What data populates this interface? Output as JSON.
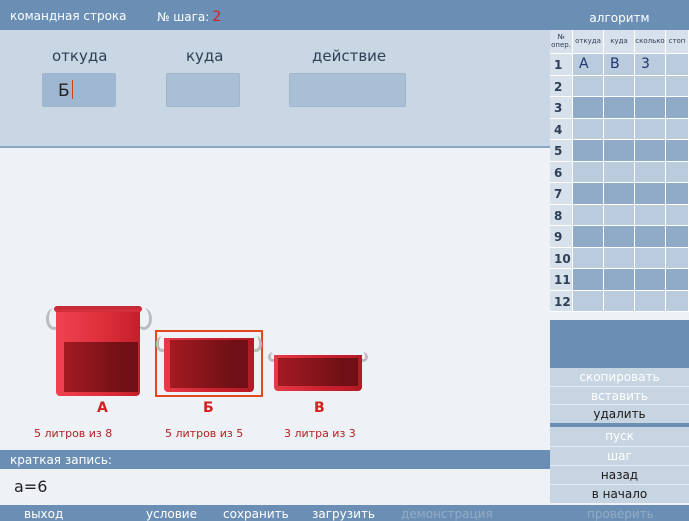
{
  "header": {
    "command_line_title": "командная строка",
    "step_label": "№ шага:",
    "step_value": "2"
  },
  "command": {
    "from_label": "откуда",
    "to_label": "куда",
    "action_label": "действие",
    "from_value": "Б",
    "to_value": "",
    "action_value": ""
  },
  "buckets": [
    {
      "letter": "А",
      "caption": "5 литров из 8"
    },
    {
      "letter": "Б",
      "caption": "5 литров из 5"
    },
    {
      "letter": "В",
      "caption": "3 литра из 3"
    }
  ],
  "brief": {
    "title": "краткая запись:",
    "text": "а=6"
  },
  "algorithm": {
    "title": "алгоритм",
    "columns": [
      "№ опер.",
      "откуда",
      "куда",
      "сколько",
      "стоп"
    ],
    "col_no_line1": "№",
    "col_no_line2": "опер.",
    "rows": [
      {
        "no": "1",
        "from": "А",
        "to": "В",
        "amount": "3",
        "stop": ""
      },
      {
        "no": "2"
      },
      {
        "no": "3"
      },
      {
        "no": "4"
      },
      {
        "no": "5"
      },
      {
        "no": "6"
      },
      {
        "no": "7"
      },
      {
        "no": "8"
      },
      {
        "no": "9"
      },
      {
        "no": "10"
      },
      {
        "no": "11"
      },
      {
        "no": "12"
      }
    ]
  },
  "panel_buttons": {
    "copy": "скопировать",
    "paste": "вставить",
    "delete": "удалить",
    "run": "пуск",
    "step": "шаг",
    "back": "назад",
    "to_start": "в начало"
  },
  "bottom": {
    "exit": "выход",
    "condition": "условие",
    "save": "сохранить",
    "load": "загрузить",
    "demo": "демонстрация",
    "check": "проверить"
  }
}
